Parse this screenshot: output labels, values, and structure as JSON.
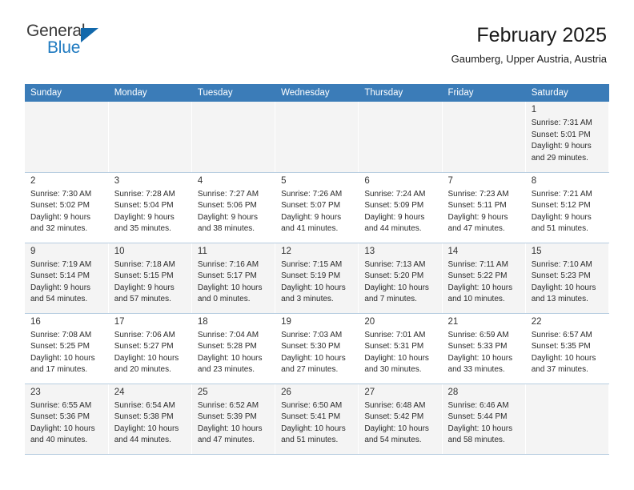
{
  "brand": {
    "name_top": "General",
    "name_bottom": "Blue",
    "triangle_color": "#1168ab",
    "accent_color": "#3b7cb8"
  },
  "header": {
    "title": "February 2025",
    "location": "Gaumberg, Upper Austria, Austria"
  },
  "calendar": {
    "weekday_headers": [
      "Sunday",
      "Monday",
      "Tuesday",
      "Wednesday",
      "Thursday",
      "Friday",
      "Saturday"
    ],
    "weeks": [
      [
        {
          "empty": true
        },
        {
          "empty": true
        },
        {
          "empty": true
        },
        {
          "empty": true
        },
        {
          "empty": true
        },
        {
          "empty": true
        },
        {
          "day": "1",
          "sunrise": "Sunrise: 7:31 AM",
          "sunset": "Sunset: 5:01 PM",
          "daylight_line1": "Daylight: 9 hours",
          "daylight_line2": "and 29 minutes."
        }
      ],
      [
        {
          "day": "2",
          "sunrise": "Sunrise: 7:30 AM",
          "sunset": "Sunset: 5:02 PM",
          "daylight_line1": "Daylight: 9 hours",
          "daylight_line2": "and 32 minutes."
        },
        {
          "day": "3",
          "sunrise": "Sunrise: 7:28 AM",
          "sunset": "Sunset: 5:04 PM",
          "daylight_line1": "Daylight: 9 hours",
          "daylight_line2": "and 35 minutes."
        },
        {
          "day": "4",
          "sunrise": "Sunrise: 7:27 AM",
          "sunset": "Sunset: 5:06 PM",
          "daylight_line1": "Daylight: 9 hours",
          "daylight_line2": "and 38 minutes."
        },
        {
          "day": "5",
          "sunrise": "Sunrise: 7:26 AM",
          "sunset": "Sunset: 5:07 PM",
          "daylight_line1": "Daylight: 9 hours",
          "daylight_line2": "and 41 minutes."
        },
        {
          "day": "6",
          "sunrise": "Sunrise: 7:24 AM",
          "sunset": "Sunset: 5:09 PM",
          "daylight_line1": "Daylight: 9 hours",
          "daylight_line2": "and 44 minutes."
        },
        {
          "day": "7",
          "sunrise": "Sunrise: 7:23 AM",
          "sunset": "Sunset: 5:11 PM",
          "daylight_line1": "Daylight: 9 hours",
          "daylight_line2": "and 47 minutes."
        },
        {
          "day": "8",
          "sunrise": "Sunrise: 7:21 AM",
          "sunset": "Sunset: 5:12 PM",
          "daylight_line1": "Daylight: 9 hours",
          "daylight_line2": "and 51 minutes."
        }
      ],
      [
        {
          "day": "9",
          "sunrise": "Sunrise: 7:19 AM",
          "sunset": "Sunset: 5:14 PM",
          "daylight_line1": "Daylight: 9 hours",
          "daylight_line2": "and 54 minutes."
        },
        {
          "day": "10",
          "sunrise": "Sunrise: 7:18 AM",
          "sunset": "Sunset: 5:15 PM",
          "daylight_line1": "Daylight: 9 hours",
          "daylight_line2": "and 57 minutes."
        },
        {
          "day": "11",
          "sunrise": "Sunrise: 7:16 AM",
          "sunset": "Sunset: 5:17 PM",
          "daylight_line1": "Daylight: 10 hours",
          "daylight_line2": "and 0 minutes."
        },
        {
          "day": "12",
          "sunrise": "Sunrise: 7:15 AM",
          "sunset": "Sunset: 5:19 PM",
          "daylight_line1": "Daylight: 10 hours",
          "daylight_line2": "and 3 minutes."
        },
        {
          "day": "13",
          "sunrise": "Sunrise: 7:13 AM",
          "sunset": "Sunset: 5:20 PM",
          "daylight_line1": "Daylight: 10 hours",
          "daylight_line2": "and 7 minutes."
        },
        {
          "day": "14",
          "sunrise": "Sunrise: 7:11 AM",
          "sunset": "Sunset: 5:22 PM",
          "daylight_line1": "Daylight: 10 hours",
          "daylight_line2": "and 10 minutes."
        },
        {
          "day": "15",
          "sunrise": "Sunrise: 7:10 AM",
          "sunset": "Sunset: 5:23 PM",
          "daylight_line1": "Daylight: 10 hours",
          "daylight_line2": "and 13 minutes."
        }
      ],
      [
        {
          "day": "16",
          "sunrise": "Sunrise: 7:08 AM",
          "sunset": "Sunset: 5:25 PM",
          "daylight_line1": "Daylight: 10 hours",
          "daylight_line2": "and 17 minutes."
        },
        {
          "day": "17",
          "sunrise": "Sunrise: 7:06 AM",
          "sunset": "Sunset: 5:27 PM",
          "daylight_line1": "Daylight: 10 hours",
          "daylight_line2": "and 20 minutes."
        },
        {
          "day": "18",
          "sunrise": "Sunrise: 7:04 AM",
          "sunset": "Sunset: 5:28 PM",
          "daylight_line1": "Daylight: 10 hours",
          "daylight_line2": "and 23 minutes."
        },
        {
          "day": "19",
          "sunrise": "Sunrise: 7:03 AM",
          "sunset": "Sunset: 5:30 PM",
          "daylight_line1": "Daylight: 10 hours",
          "daylight_line2": "and 27 minutes."
        },
        {
          "day": "20",
          "sunrise": "Sunrise: 7:01 AM",
          "sunset": "Sunset: 5:31 PM",
          "daylight_line1": "Daylight: 10 hours",
          "daylight_line2": "and 30 minutes."
        },
        {
          "day": "21",
          "sunrise": "Sunrise: 6:59 AM",
          "sunset": "Sunset: 5:33 PM",
          "daylight_line1": "Daylight: 10 hours",
          "daylight_line2": "and 33 minutes."
        },
        {
          "day": "22",
          "sunrise": "Sunrise: 6:57 AM",
          "sunset": "Sunset: 5:35 PM",
          "daylight_line1": "Daylight: 10 hours",
          "daylight_line2": "and 37 minutes."
        }
      ],
      [
        {
          "day": "23",
          "sunrise": "Sunrise: 6:55 AM",
          "sunset": "Sunset: 5:36 PM",
          "daylight_line1": "Daylight: 10 hours",
          "daylight_line2": "and 40 minutes."
        },
        {
          "day": "24",
          "sunrise": "Sunrise: 6:54 AM",
          "sunset": "Sunset: 5:38 PM",
          "daylight_line1": "Daylight: 10 hours",
          "daylight_line2": "and 44 minutes."
        },
        {
          "day": "25",
          "sunrise": "Sunrise: 6:52 AM",
          "sunset": "Sunset: 5:39 PM",
          "daylight_line1": "Daylight: 10 hours",
          "daylight_line2": "and 47 minutes."
        },
        {
          "day": "26",
          "sunrise": "Sunrise: 6:50 AM",
          "sunset": "Sunset: 5:41 PM",
          "daylight_line1": "Daylight: 10 hours",
          "daylight_line2": "and 51 minutes."
        },
        {
          "day": "27",
          "sunrise": "Sunrise: 6:48 AM",
          "sunset": "Sunset: 5:42 PM",
          "daylight_line1": "Daylight: 10 hours",
          "daylight_line2": "and 54 minutes."
        },
        {
          "day": "28",
          "sunrise": "Sunrise: 6:46 AM",
          "sunset": "Sunset: 5:44 PM",
          "daylight_line1": "Daylight: 10 hours",
          "daylight_line2": "and 58 minutes."
        },
        {
          "empty": true
        }
      ]
    ]
  }
}
